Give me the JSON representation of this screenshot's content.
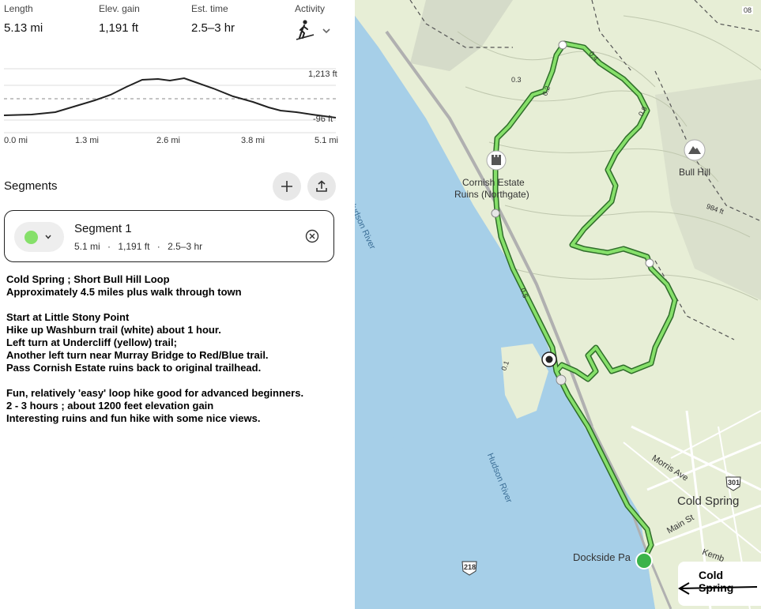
{
  "stats": {
    "length": {
      "label": "Length",
      "value": "5.13 mi"
    },
    "elev_gain": {
      "label": "Elev. gain",
      "value": "1,191 ft"
    },
    "est_time": {
      "label": "Est. time",
      "value": "2.5–3 hr"
    },
    "activity": {
      "label": "Activity",
      "icon": "hiking-icon"
    }
  },
  "elevation": {
    "max_label": "1,213 ft",
    "min_label": "-96 ft",
    "x_ticks": [
      "0.0 mi",
      "1.3 mi",
      "2.6 mi",
      "3.8 mi",
      "5.1 mi"
    ]
  },
  "segments": {
    "title": "Segments",
    "items": [
      {
        "name": "Segment 1",
        "distance": "5.1 mi",
        "elev": "1,191 ft",
        "time": "2.5–3 hr",
        "color": "#86e06a"
      }
    ]
  },
  "notes": [
    "Cold Spring ; Short Bull Hill Loop",
    "Approximately 4.5 miles plus walk through town",
    "",
    "Start at Little Stony Point",
    "Hike up Washburn trail (white) about 1 hour.",
    "Left turn at Undercliff (yellow) trail;",
    "Another left turn near Murray Bridge to Red/Blue trail.",
    "Pass Cornish Estate ruins back to original trailhead.",
    "",
    "Fun, relatively 'easy' loop hike good for advanced beginners.",
    "2 - 3 hours ; about 1200 feet elevation gain",
    "Interesting ruins and fun hike with some nice views."
  ],
  "map": {
    "labels": {
      "cornish_1": "Cornish Estate",
      "cornish_2": "Ruins (Northgate)",
      "bull_hill": "Bull Hill",
      "hudson_1": "Hudson River",
      "hudson_2": "Hudson River",
      "cold_spring": "Cold Spring",
      "dockside": "Dockside Pa",
      "morris_ave": "Morris Ave",
      "main_st": "Main St",
      "kemble": "Kemb",
      "route_301": "301",
      "route_218": "218",
      "annotation": "Cold Spring",
      "dist_04": "0.4",
      "dist_03": "0.3",
      "dist_02": "0.2",
      "dist_05": "0.5",
      "dist_01": "0.1",
      "dist_08": "0.8",
      "dist_08b": "08",
      "elev_984": "984 ft"
    },
    "colors": {
      "water": "#a6cfe8",
      "land": "#e9efd9",
      "trail": "#6bd15c",
      "trail_dark": "#2f6d2a"
    }
  }
}
